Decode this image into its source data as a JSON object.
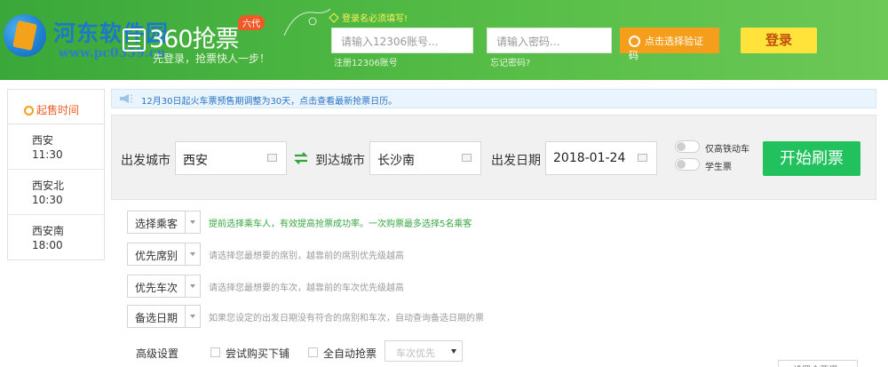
{
  "header": {
    "watermark_text": "河东软件园",
    "watermark_url": "www.pc0359.cn",
    "brand_name": "360抢票",
    "brand_subtitle": "先登录，抢票快人一步！",
    "version_badge": "六代",
    "notice": "登录名必须填写!",
    "username_placeholder": "请输入12306账号...",
    "password_placeholder": "请输入密码...",
    "register_link": "注册12306账号",
    "forgot_link": "忘记密码?",
    "captcha_button": "点击选择验证码",
    "login_button": "登录"
  },
  "sidebar": {
    "title": "起售时间",
    "items": [
      {
        "station": "西安",
        "time": "11:30"
      },
      {
        "station": "西安北",
        "time": "10:30"
      },
      {
        "station": "西安南",
        "time": "18:00"
      }
    ]
  },
  "announcement": "12月30日起火车票预售期调整为30天，点击查看最新抢票日历。",
  "search": {
    "from_label": "出发城市",
    "from_value": "西安",
    "to_label": "到达城市",
    "to_value": "长沙南",
    "date_label": "出发日期",
    "date_value": "2018-01-24",
    "toggle_hsr": "仅高铁动车",
    "toggle_student": "学生票",
    "start_button": "开始刷票"
  },
  "options": [
    {
      "label": "选择乘客",
      "hint": "提前选择乘车人，有效提高抢票成功率。一次购票最多选择5名乘客"
    },
    {
      "label": "优先席别",
      "hint": "请选择您最想要的席别，越靠前的席别优先级越高"
    },
    {
      "label": "优先车次",
      "hint": "请选择您最想要的车次，越靠前的车次优先级越高"
    },
    {
      "label": "备选日期",
      "hint": "如果您设定的出发日期没有符合的席别和车次，自动查询备选日期的票"
    }
  ],
  "advanced": {
    "label": "高级设置",
    "try_lower_berth": "尝试购买下铺",
    "auto_grab": "全自动抢票",
    "priority_select": "车次优先",
    "cut_button": "* 设置余票阈"
  },
  "colors": {
    "header_green": "#4cb843",
    "start_button": "#21c25d",
    "login_button": "#ffe33b",
    "captcha_button": "#f59e1b",
    "accent_orange": "#ef5b24"
  }
}
